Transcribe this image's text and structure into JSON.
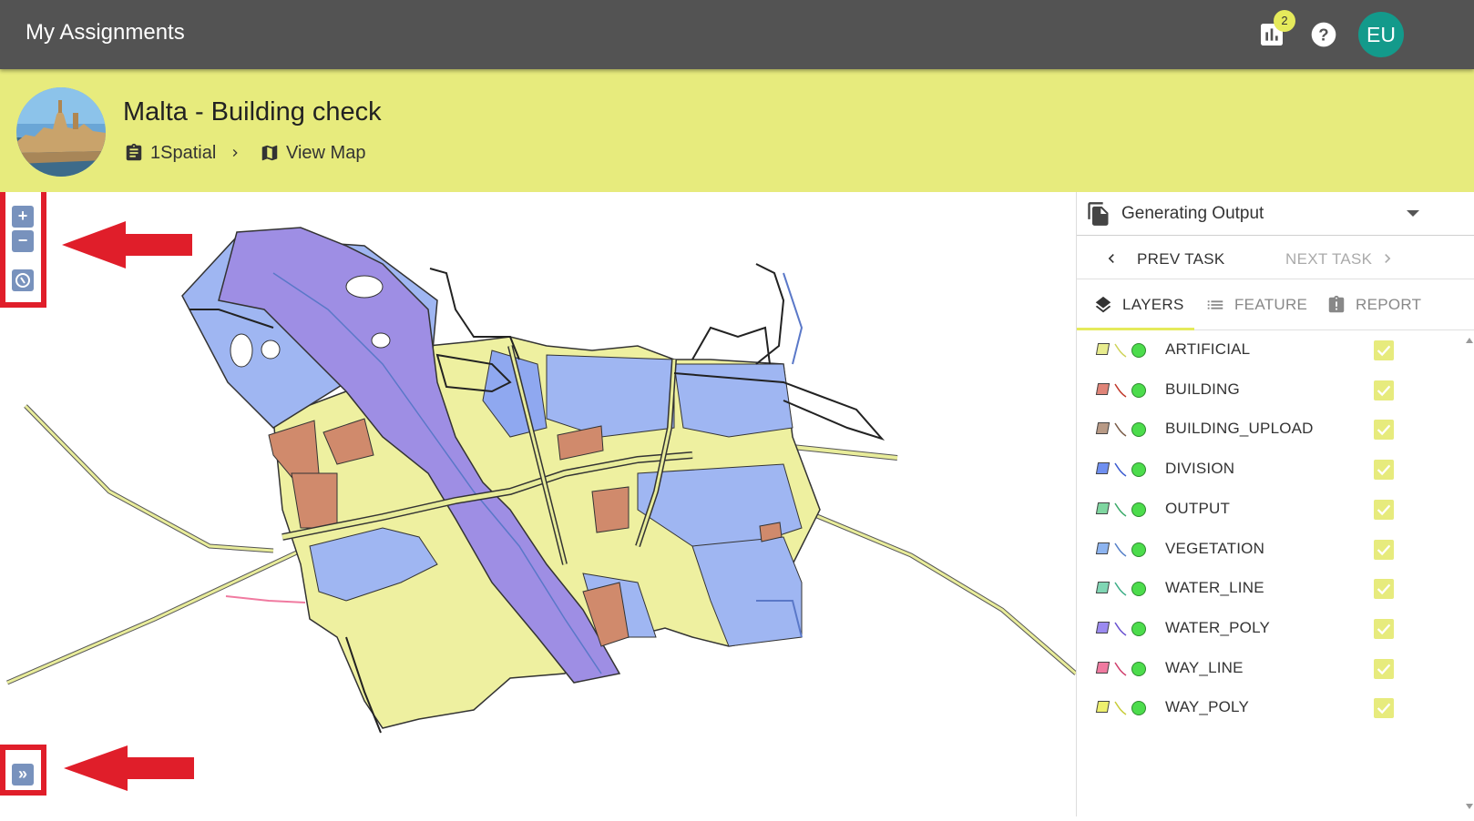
{
  "app": {
    "title": "My Assignments"
  },
  "topbar": {
    "notification_count": "2",
    "user_initials": "EU",
    "icons": [
      "bar-chart-icon",
      "help-icon"
    ]
  },
  "project": {
    "title": "Malta - Building check",
    "breadcrumb": {
      "org": "1Spatial",
      "view": "View Map"
    }
  },
  "map_controls": {
    "zoom_in": "+",
    "zoom_out": "−",
    "expand": "»",
    "highlight_color": "#e01e2a"
  },
  "panel": {
    "task_select": {
      "value": "Generating Output"
    },
    "nav": {
      "prev": "PREV TASK",
      "next": "NEXT TASK"
    },
    "tabs": [
      {
        "label": "LAYERS",
        "icon": "layers-icon",
        "active": true
      },
      {
        "label": "FEATURE",
        "icon": "list-icon",
        "active": false
      },
      {
        "label": "REPORT",
        "icon": "report-icon",
        "active": false
      }
    ],
    "layers": [
      {
        "name": "ARTIFICIAL",
        "poly": "#e8ec8e",
        "line": "#cfd35a",
        "checked": true
      },
      {
        "name": "BUILDING",
        "poly": "#e08478",
        "line": "#c0392b",
        "checked": true
      },
      {
        "name": "BUILDING_UPLOAD",
        "poly": "#b89a86",
        "line": "#7a5c48",
        "checked": true
      },
      {
        "name": "DIVISION",
        "poly": "#6f8ff0",
        "line": "#3b5bd0",
        "checked": true
      },
      {
        "name": "OUTPUT",
        "poly": "#7fd6a0",
        "line": "#3caa6a",
        "checked": true
      },
      {
        "name": "VEGETATION",
        "poly": "#8db4f0",
        "line": "#5680c8",
        "checked": true
      },
      {
        "name": "WATER_LINE",
        "poly": "#80d6b4",
        "line": "#3fae88",
        "checked": true
      },
      {
        "name": "WATER_POLY",
        "poly": "#9b8af0",
        "line": "#6a52d0",
        "checked": true
      },
      {
        "name": "WAY_LINE",
        "poly": "#f07aa0",
        "line": "#d0406e",
        "checked": true
      },
      {
        "name": "WAY_POLY",
        "poly": "#eef06e",
        "line": "#c8cc3a",
        "checked": true
      }
    ]
  },
  "colors": {
    "accent": "#e5ea5b",
    "header_bg": "#535353",
    "project_bg": "#e7eb7d",
    "avatar": "#139a8b"
  }
}
